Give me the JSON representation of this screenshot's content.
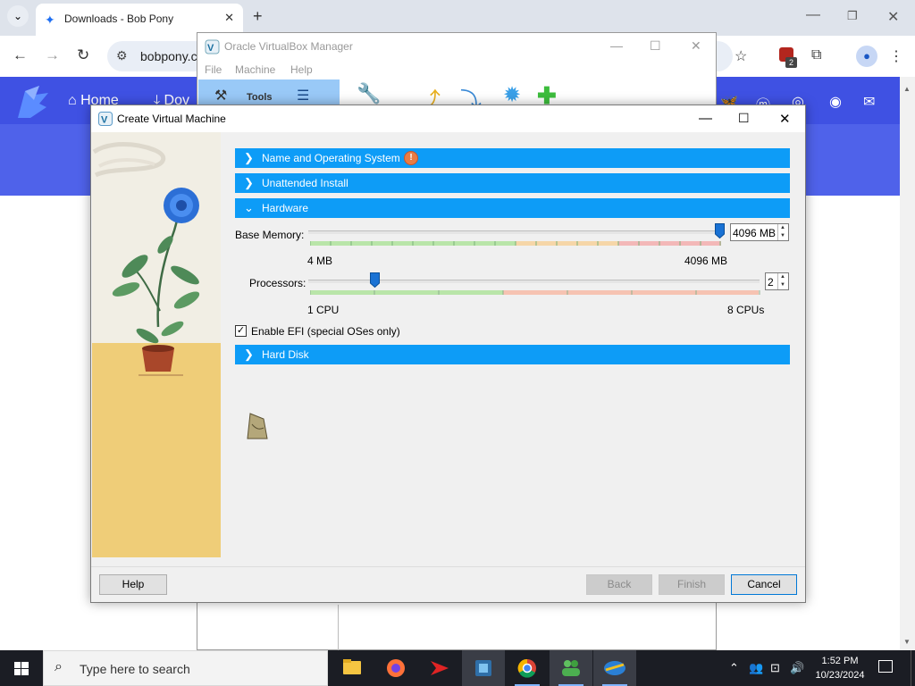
{
  "browser": {
    "tab_title": "Downloads - Bob Pony",
    "address": "bobpony.c",
    "extension_badge_count": "2"
  },
  "site": {
    "nav_home": "Home",
    "nav_downloads_partial": "Dov",
    "header_color": "#3f51e3"
  },
  "vbox_manager": {
    "title": "Oracle VirtualBox Manager",
    "menu": [
      "File",
      "Machine",
      "Help"
    ],
    "tools_label": "Tools"
  },
  "dialog": {
    "title": "Create Virtual Machine",
    "sections": {
      "name_os": "Name and Operating System",
      "unattended": "Unattended Install",
      "hardware": "Hardware",
      "hard_disk": "Hard Disk"
    },
    "base_memory": {
      "label": "Base Memory:",
      "value": "4096 MB",
      "min_label": "4 MB",
      "max_label": "4096 MB",
      "level": 1.0
    },
    "processors": {
      "label": "Processors:",
      "value": "2",
      "min_label": "1 CPU",
      "max_label": "8 CPUs",
      "level": 0.143
    },
    "efi": {
      "label": "Enable EFI (special OSes only)",
      "checked": true,
      "mark": "✓"
    },
    "buttons": {
      "help": "Help",
      "back": "Back",
      "finish": "Finish",
      "cancel": "Cancel"
    },
    "accent_color": "#0d9cf7"
  },
  "taskbar": {
    "search_placeholder": "Type here to search",
    "time": "1:52 PM",
    "date": "10/23/2024"
  }
}
